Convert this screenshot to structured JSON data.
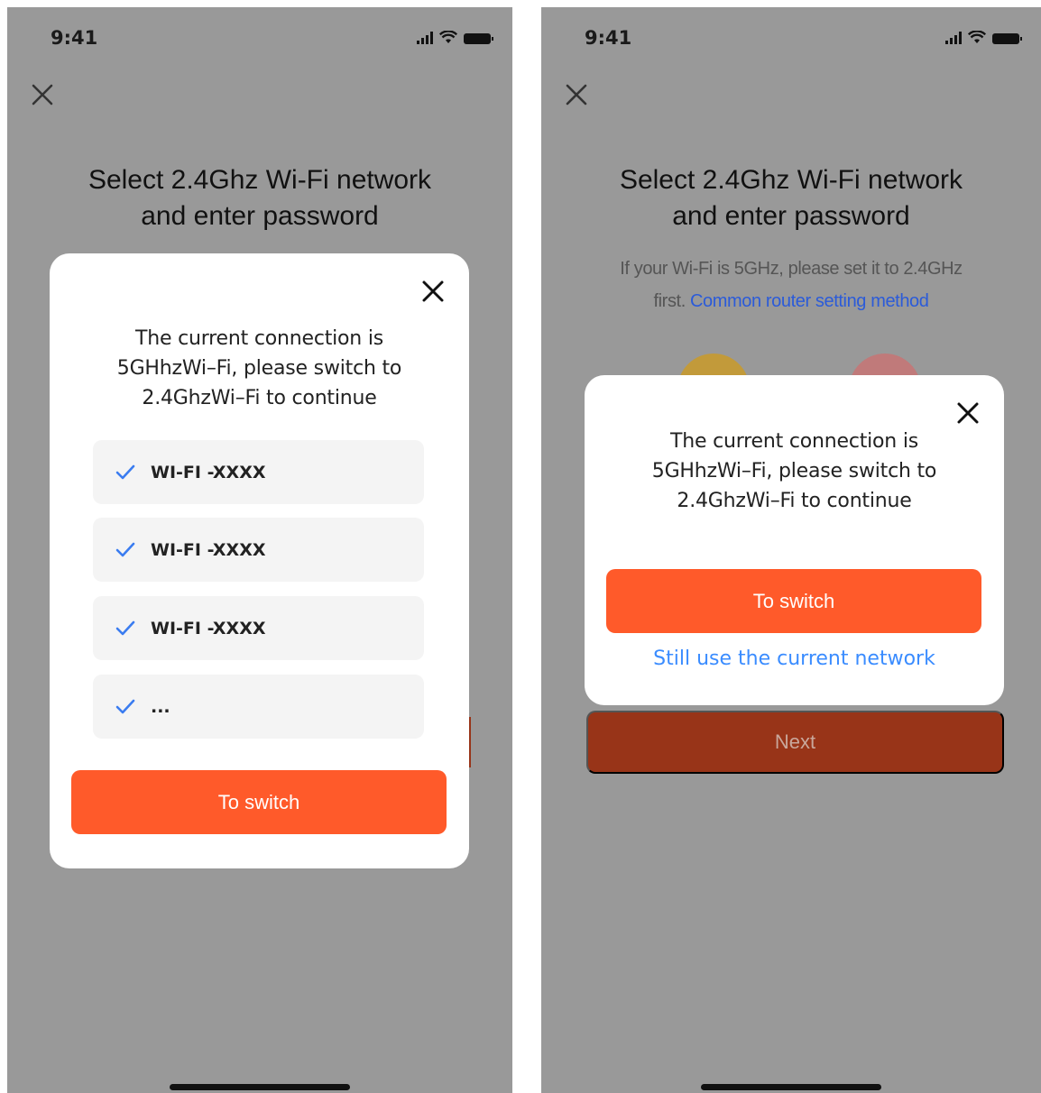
{
  "colors": {
    "accent": "#ff5a2a",
    "link": "#3a8cff",
    "next_button": "#983418",
    "overlay": "#999999",
    "circle_yellow": "#c29a3a",
    "circle_pink": "#c07a7a"
  },
  "status_bar": {
    "time": "9:41"
  },
  "left_screen": {
    "title_line1": "Select 2.4Ghz Wi-Fi network",
    "title_line2": "and enter password",
    "modal": {
      "message_line1": "The current connection is",
      "message_line2": "5GHhzWi–Fi, please switch to",
      "message_line3": "2.4GhzWi–Fi to continue",
      "networks": [
        "WI-FI -XXXX",
        "WI-FI -XXXX",
        "WI-FI -XXXX",
        "..."
      ],
      "switch_label": "To switch"
    }
  },
  "right_screen": {
    "title_line1": "Select 2.4Ghz Wi-Fi network",
    "title_line2": "and enter password",
    "hint_line1": "If your Wi-Fi is 5GHz, please set it to 2.4GHz",
    "hint_prefix": "first. ",
    "hint_link": "Common router setting method",
    "modal": {
      "message_line1": "The current connection is",
      "message_line2": "5GHhzWi–Fi, please switch to",
      "message_line3": "2.4GhzWi–Fi to continue",
      "switch_label": "To switch",
      "still_use_label": "Still use the current network"
    },
    "next_label": "Next"
  }
}
